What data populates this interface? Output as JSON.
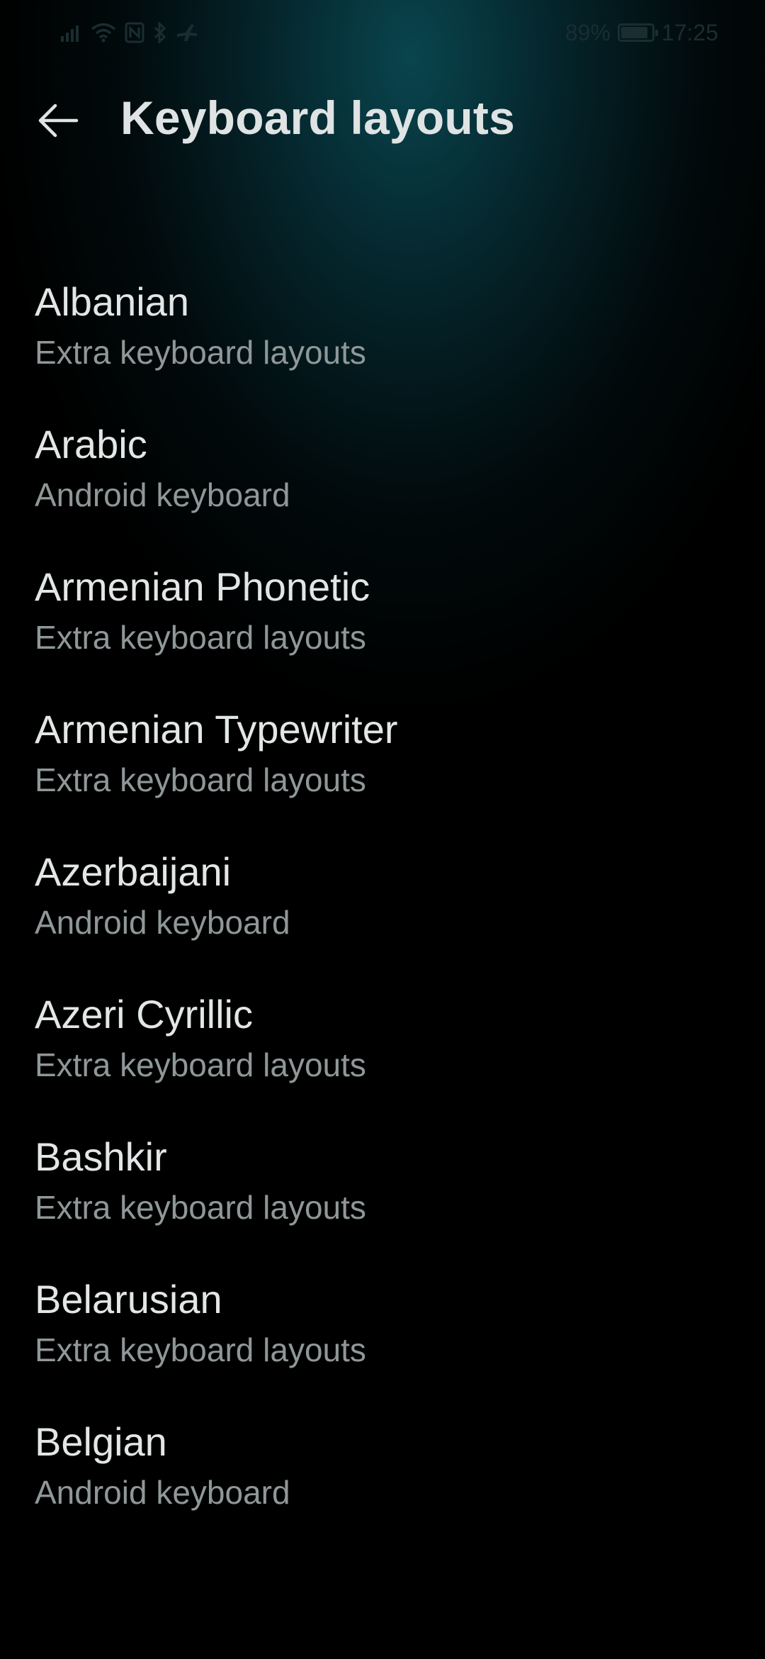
{
  "status_bar": {
    "battery_percent": "89%",
    "battery_level": 0.89,
    "time": "17:25",
    "icons": [
      "signal-icon",
      "wifi-icon",
      "nfc-icon",
      "bluetooth-icon",
      "airplane-icon"
    ]
  },
  "header": {
    "title": "Keyboard layouts",
    "back_icon": "arrow-left-icon"
  },
  "layouts": [
    {
      "name": "Albanian",
      "source": "Extra keyboard layouts"
    },
    {
      "name": "Arabic",
      "source": "Android keyboard"
    },
    {
      "name": "Armenian Phonetic",
      "source": "Extra keyboard layouts"
    },
    {
      "name": "Armenian Typewriter",
      "source": "Extra keyboard layouts"
    },
    {
      "name": "Azerbaijani",
      "source": "Android keyboard"
    },
    {
      "name": "Azeri Cyrillic",
      "source": "Extra keyboard layouts"
    },
    {
      "name": "Bashkir",
      "source": "Extra keyboard layouts"
    },
    {
      "name": "Belarusian",
      "source": "Extra keyboard layouts"
    },
    {
      "name": "Belgian",
      "source": "Android keyboard"
    }
  ],
  "colors": {
    "accent_glow": "#0a4852",
    "title_text": "#e3e6e6",
    "subtitle_text": "#8f9798"
  }
}
